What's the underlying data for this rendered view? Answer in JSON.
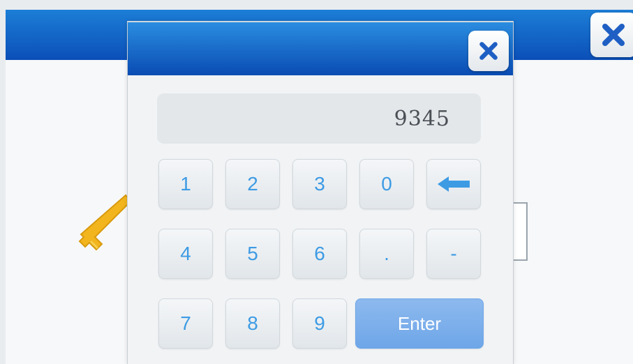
{
  "background": {
    "close_icon": "close-icon",
    "key_icon": "key-icon"
  },
  "dialog": {
    "close_icon": "close-icon",
    "display_value": "9345",
    "keys": {
      "k1": "1",
      "k2": "2",
      "k3": "3",
      "k0": "0",
      "backspace_icon": "left-arrow-icon",
      "k4": "4",
      "k5": "5",
      "k6": "6",
      "dot": ".",
      "minus": "-",
      "k7": "7",
      "k8": "8",
      "k9": "9",
      "enter": "Enter"
    }
  },
  "colors": {
    "header_blue": "#0b4fb8",
    "key_text": "#3d9be4",
    "enter_bg": "#7aaeea",
    "close_x": "#1f5fc4"
  }
}
